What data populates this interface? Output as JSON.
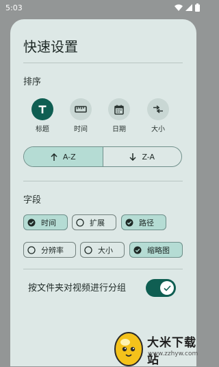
{
  "status": {
    "time": "5:03"
  },
  "sheet": {
    "title": "快速设置"
  },
  "sort": {
    "label": "排序",
    "options": [
      {
        "label": "标题",
        "icon": "title-T-icon",
        "selected": true
      },
      {
        "label": "时间",
        "icon": "clock-ruler-icon",
        "selected": false
      },
      {
        "label": "日期",
        "icon": "calendar-icon",
        "selected": false
      },
      {
        "label": "大小",
        "icon": "size-arrows-icon",
        "selected": false
      }
    ],
    "order": {
      "asc_label": "A-Z",
      "desc_label": "Z-A",
      "selected": "A-Z"
    }
  },
  "fields": {
    "label": "字段",
    "chips": [
      {
        "label": "时间",
        "checked": true
      },
      {
        "label": "扩展",
        "checked": false
      },
      {
        "label": "路径",
        "checked": true
      },
      {
        "label": "分辨率",
        "checked": false
      },
      {
        "label": "大小",
        "checked": false
      },
      {
        "label": "缩略图",
        "checked": true
      }
    ]
  },
  "group_toggle": {
    "label": "按文件夹对视频进行分组",
    "on": true
  },
  "watermark": {
    "title": "大米下载站",
    "url": "www.zzhyw.com"
  },
  "colors": {
    "accent": "#0f5e52",
    "chip_checked": "#b5dcd4",
    "sheet_bg": "#dde8e6"
  }
}
